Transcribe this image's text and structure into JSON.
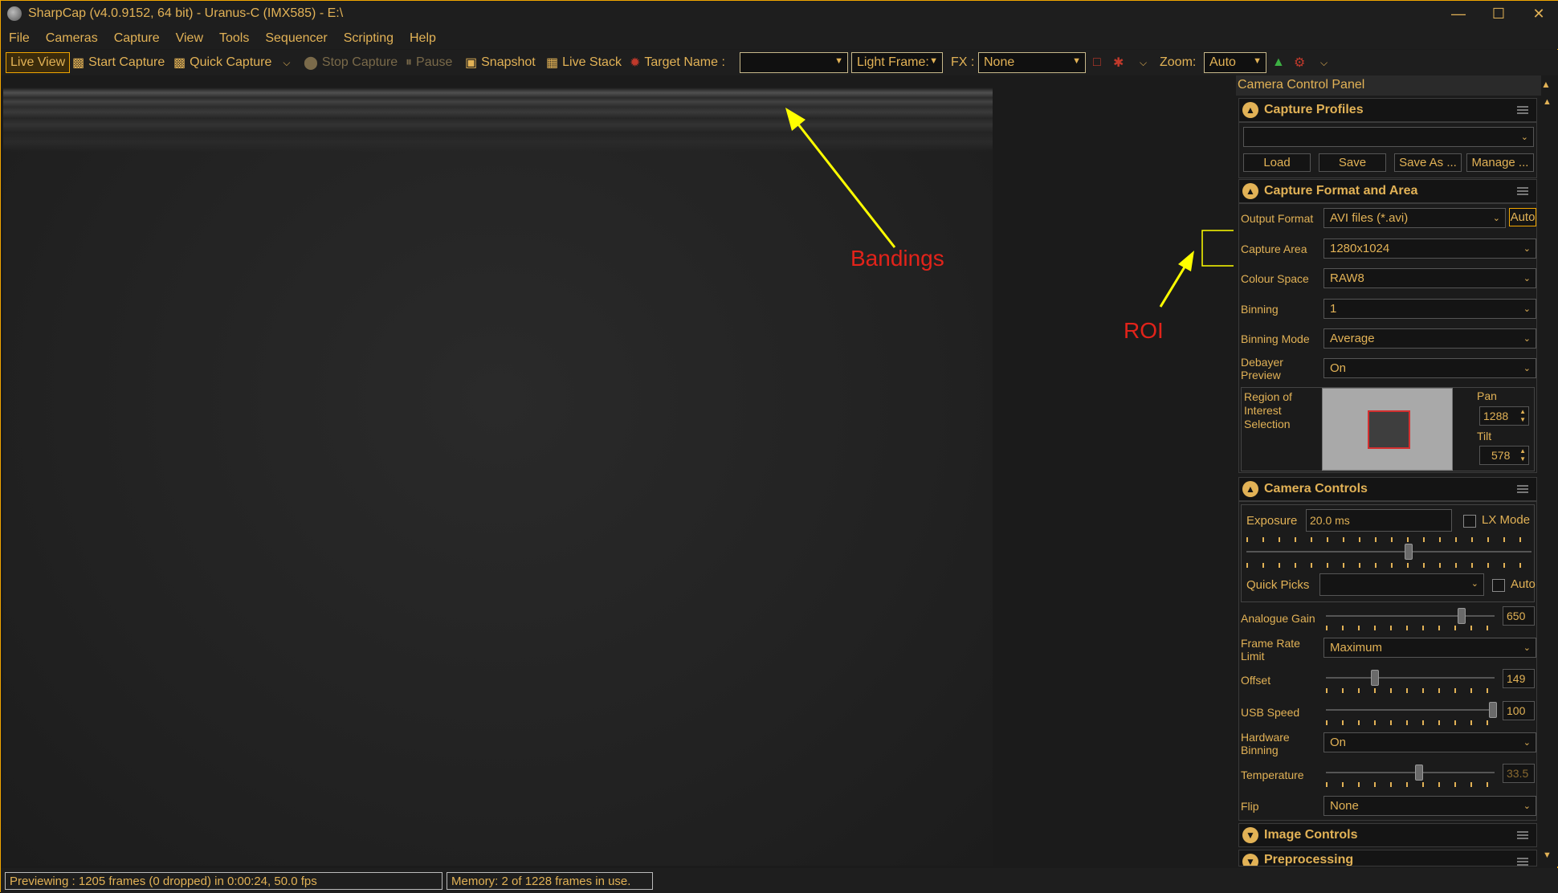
{
  "window": {
    "title": "SharpCap (v4.0.9152, 64 bit) - Uranus-C (IMX585) - E:\\",
    "minimize_icon": "minimize-icon",
    "maximize_icon": "maximize-icon",
    "close_icon": "close-icon"
  },
  "menu": [
    "File",
    "Cameras",
    "Capture",
    "View",
    "Tools",
    "Sequencer",
    "Scripting",
    "Help"
  ],
  "toolbar": {
    "live_view": "Live View",
    "start_capture": "Start Capture",
    "quick_capture": "Quick Capture",
    "stop_capture": "Stop Capture",
    "pause": "Pause",
    "snapshot": "Snapshot",
    "live_stack": "Live Stack",
    "target_name_label": "Target Name :",
    "target_name_value": "",
    "frame_type": "Light Frame:",
    "fx_label": "FX :",
    "fx_value": "None",
    "zoom_label": "Zoom:",
    "zoom_value": "Auto"
  },
  "annotations": {
    "bandings": "Bandings",
    "roi": "ROI"
  },
  "panel": {
    "title": "Camera Control Panel",
    "capture_profiles": {
      "header": "Capture Profiles",
      "profile_value": "",
      "load": "Load",
      "save": "Save",
      "save_as": "Save As ...",
      "manage": "Manage ..."
    },
    "capture_format": {
      "header": "Capture Format and Area",
      "output_format_label": "Output Format",
      "output_format_value": "AVI files (*.avi)",
      "auto_button": "Auto",
      "capture_area_label": "Capture Area",
      "capture_area_value": "1280x1024",
      "colour_space_label": "Colour Space",
      "colour_space_value": "RAW8",
      "binning_label": "Binning",
      "binning_value": "1",
      "binning_mode_label": "Binning Mode",
      "binning_mode_value": "Average",
      "debayer_label_1": "Debayer",
      "debayer_label_2": "Preview",
      "debayer_value": "On",
      "roi_label_1": "Region of",
      "roi_label_2": "Interest",
      "roi_label_3": "Selection",
      "pan_label": "Pan",
      "pan_value": "1288",
      "tilt_label": "Tilt",
      "tilt_value": "578"
    },
    "camera_controls": {
      "header": "Camera Controls",
      "exposure_label": "Exposure",
      "exposure_value": "20.0 ms",
      "lx_mode": "LX Mode",
      "quick_picks_label": "Quick Picks",
      "quick_picks_value": "",
      "auto_label": "Auto",
      "analogue_gain_label": "Analogue Gain",
      "analogue_gain_value": "650",
      "frame_rate_label_1": "Frame Rate",
      "frame_rate_label_2": "Limit",
      "frame_rate_value": "Maximum",
      "offset_label": "Offset",
      "offset_value": "149",
      "usb_speed_label": "USB Speed",
      "usb_speed_value": "100",
      "hw_binning_label_1": "Hardware",
      "hw_binning_label_2": "Binning",
      "hw_binning_value": "On",
      "temperature_label": "Temperature",
      "temperature_value": "33.5",
      "flip_label": "Flip",
      "flip_value": "None"
    },
    "image_controls": {
      "header": "Image Controls"
    },
    "preprocessing": {
      "header": "Preprocessing"
    }
  },
  "status": {
    "previewing": "Previewing : 1205 frames (0 dropped) in 0:00:24, 50.0 fps",
    "memory": "Memory: 2 of 1228 frames in use."
  },
  "colors": {
    "accent": "#e2b256",
    "highlight": "#f0a500",
    "annotation_red": "#e2231a",
    "annotation_yellow": "#ffff00"
  }
}
